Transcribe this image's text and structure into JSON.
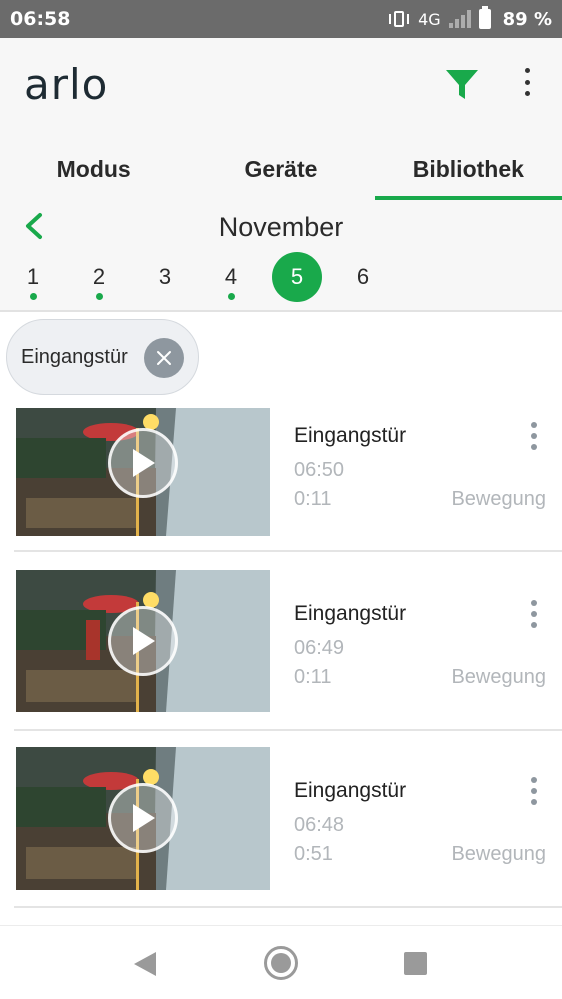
{
  "status_bar": {
    "time": "06:58",
    "network": "4G",
    "battery": "89 %"
  },
  "header": {
    "logo": "arlo"
  },
  "tabs": [
    {
      "label": "Modus",
      "active": false
    },
    {
      "label": "Geräte",
      "active": false
    },
    {
      "label": "Bibliothek",
      "active": true
    }
  ],
  "calendar": {
    "month": "November",
    "days": [
      {
        "label": "1",
        "has_recordings": true
      },
      {
        "label": "2",
        "has_recordings": true
      },
      {
        "label": "3",
        "has_recordings": false
      },
      {
        "label": "4",
        "has_recordings": true
      },
      {
        "label": "5",
        "selected": true
      },
      {
        "label": "6",
        "has_recordings": false
      }
    ]
  },
  "filter_chip": {
    "label": "Eingangstür"
  },
  "clips": [
    {
      "device": "Eingangstür",
      "time": "06:50",
      "duration": "0:11",
      "type": "Bewegung"
    },
    {
      "device": "Eingangstür",
      "time": "06:49",
      "duration": "0:11",
      "type": "Bewegung"
    },
    {
      "device": "Eingangstür",
      "time": "06:48",
      "duration": "0:51",
      "type": "Bewegung"
    }
  ],
  "colors": {
    "accent": "#19a94b",
    "muted_text": "#b2b6ba",
    "status_bar": "#6b6b6b"
  },
  "icons": [
    "vibrate-icon",
    "signal-icon",
    "battery-icon",
    "filter-icon",
    "more-icon",
    "back-icon",
    "close-icon",
    "play-icon",
    "nav-back-icon",
    "nav-home-icon",
    "nav-recent-icon"
  ]
}
